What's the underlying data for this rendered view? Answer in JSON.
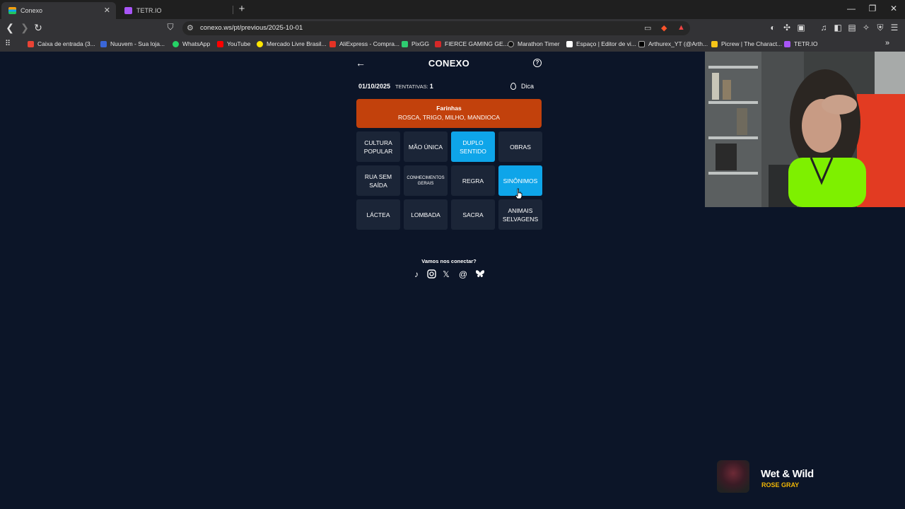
{
  "browser": {
    "tabs": [
      {
        "title": "Conexo",
        "active": true
      },
      {
        "title": "TETR.IO",
        "active": false
      }
    ],
    "url": "conexo.ws/pt/previous/2025-10-01",
    "bookmarks": [
      {
        "label": "Caixa de entrada (3...",
        "color": "#ea4335"
      },
      {
        "label": "Nuuvem - Sua loja...",
        "color": "#3a66d8"
      },
      {
        "label": "WhatsApp",
        "color": "#25d366"
      },
      {
        "label": "YouTube",
        "color": "#ff0000"
      },
      {
        "label": "Mercado Livre Brasil...",
        "color": "#ffe600"
      },
      {
        "label": "AliExpress - Compra...",
        "color": "#e43225"
      },
      {
        "label": "PixGG",
        "color": "#2ecc71"
      },
      {
        "label": "FIERCE GAMING GE...",
        "color": "#d62828"
      },
      {
        "label": "Marathon Timer",
        "color": "#222222"
      },
      {
        "label": "Espaço | Editor de vi...",
        "color": "#ffffff"
      },
      {
        "label": "Arthurex_YT (@Arth...",
        "color": "#ffffff"
      },
      {
        "label": "Picrew | The Charact...",
        "color": "#f5c518"
      },
      {
        "label": "TETR.IO",
        "color": "#a855f7"
      }
    ]
  },
  "game": {
    "title": "CONEXO",
    "date": "01/10/2025",
    "attempts_label": "TENTATIVAS:",
    "attempts_value": "1",
    "hint_label": "Dica",
    "solved_group": {
      "title": "Farinhas",
      "words": "ROSCA, TRIGO, MILHO, MANDIOCA",
      "color": "#c2410c"
    },
    "words": [
      {
        "text": "CULTURA POPULAR",
        "selected": false
      },
      {
        "text": "MÃO ÚNICA",
        "selected": false
      },
      {
        "text": "DUPLO SENTIDO",
        "selected": true
      },
      {
        "text": "OBRAS",
        "selected": false
      },
      {
        "text": "RUA SEM SAÍDA",
        "selected": false
      },
      {
        "text": "CONHECIMENTOS GERAIS",
        "selected": false
      },
      {
        "text": "REGRA",
        "selected": false
      },
      {
        "text": "SINÔNIMOS",
        "selected": true
      },
      {
        "text": "LÁCTEA",
        "selected": false
      },
      {
        "text": "LOMBADA",
        "selected": false
      },
      {
        "text": "SACRA",
        "selected": false
      },
      {
        "text": "ANIMAIS SELVAGENS",
        "selected": false
      }
    ],
    "selected_color": "#0ea5e9",
    "connect_text": "Vamos nos conectar?",
    "socials": [
      "tiktok-icon",
      "instagram-icon",
      "x-icon",
      "threads-icon",
      "bluesky-icon"
    ]
  },
  "now_playing": {
    "title": "Wet & Wild",
    "artist": "ROSE GRAY"
  }
}
